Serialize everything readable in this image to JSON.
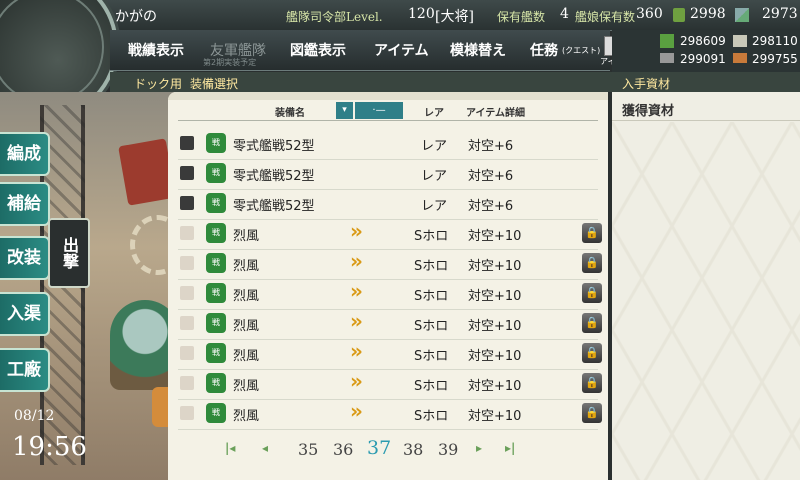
{
  "header": {
    "player_name": "かがの",
    "hq_level_label": "艦隊司令部Level.",
    "hq_level": "120",
    "rank": "[大将]",
    "ships_label": "保有艦数",
    "ships_count": "4",
    "equip_label": "艦娘保有数",
    "equip_count": "360",
    "bucket": "2998",
    "devmat": "2973"
  },
  "menu": {
    "items": [
      "戦績表示",
      "友軍艦隊",
      "図鑑表示",
      "アイテム",
      "模様替え",
      "任務"
    ],
    "quest_sub": "(クエスト)",
    "friend_sub": "第2期実装予定",
    "itemshop": "アイテム屋"
  },
  "resources": {
    "fuel": "298609",
    "ammo": "298110",
    "steel": "299091",
    "bauxite": "299755"
  },
  "breadcrumb": {
    "dock": "ドック用",
    "page": "装備選択"
  },
  "table": {
    "headers": {
      "name": "装備名",
      "rarity": "レア",
      "detail": "アイテム詳細"
    },
    "sort_label": "·—",
    "rows": [
      {
        "checked": true,
        "icon": "zero-fighter-icon",
        "name": "零式艦戦52型",
        "rarity": "レア",
        "detail": "対空+6",
        "chevrons": "",
        "locked": false
      },
      {
        "checked": true,
        "icon": "zero-fighter-icon",
        "name": "零式艦戦52型",
        "rarity": "レア",
        "detail": "対空+6",
        "chevrons": "",
        "locked": false
      },
      {
        "checked": true,
        "icon": "zero-fighter-icon",
        "name": "零式艦戦52型",
        "rarity": "レア",
        "detail": "対空+6",
        "chevrons": "",
        "locked": false
      },
      {
        "checked": false,
        "icon": "reppu-fighter-icon",
        "name": "烈風",
        "rarity": "Sホロ",
        "detail": "対空+10",
        "chevrons": "»",
        "locked": true
      },
      {
        "checked": false,
        "icon": "reppu-fighter-icon",
        "name": "烈風",
        "rarity": "Sホロ",
        "detail": "対空+10",
        "chevrons": "»",
        "locked": true
      },
      {
        "checked": false,
        "icon": "reppu-fighter-icon",
        "name": "烈風",
        "rarity": "Sホロ",
        "detail": "対空+10",
        "chevrons": "»",
        "locked": true
      },
      {
        "checked": false,
        "icon": "reppu-fighter-icon",
        "name": "烈風",
        "rarity": "Sホロ",
        "detail": "対空+10",
        "chevrons": "»",
        "locked": true
      },
      {
        "checked": false,
        "icon": "reppu-fighter-icon",
        "name": "烈風",
        "rarity": "Sホロ",
        "detail": "対空+10",
        "chevrons": "»",
        "locked": true
      },
      {
        "checked": false,
        "icon": "reppu-fighter-icon",
        "name": "烈風",
        "rarity": "Sホロ",
        "detail": "対空+10",
        "chevrons": "»",
        "locked": true
      },
      {
        "checked": false,
        "icon": "reppu-fighter-icon",
        "name": "烈風",
        "rarity": "Sホロ",
        "detail": "対空+10",
        "chevrons": "»",
        "locked": true
      }
    ]
  },
  "pagination": {
    "first": "|◂",
    "prev": "◂",
    "pages": [
      "35",
      "36",
      "37",
      "38",
      "39"
    ],
    "current": "37",
    "next": "▸",
    "last": "▸|"
  },
  "right_panel": {
    "title": "入手資材",
    "subtitle": "獲得資材"
  },
  "sidebar": {
    "buttons": [
      "編成",
      "補給",
      "改装",
      "入渠",
      "工廠"
    ],
    "sortie": "出撃"
  },
  "clock": {
    "date": "08/12",
    "time": "19:56"
  },
  "colors": {
    "accent_teal": "#2f7f88",
    "current_page": "#2b9bb0",
    "chevron_gold": "#d99a16",
    "equip_green": "#2f8a3b"
  }
}
